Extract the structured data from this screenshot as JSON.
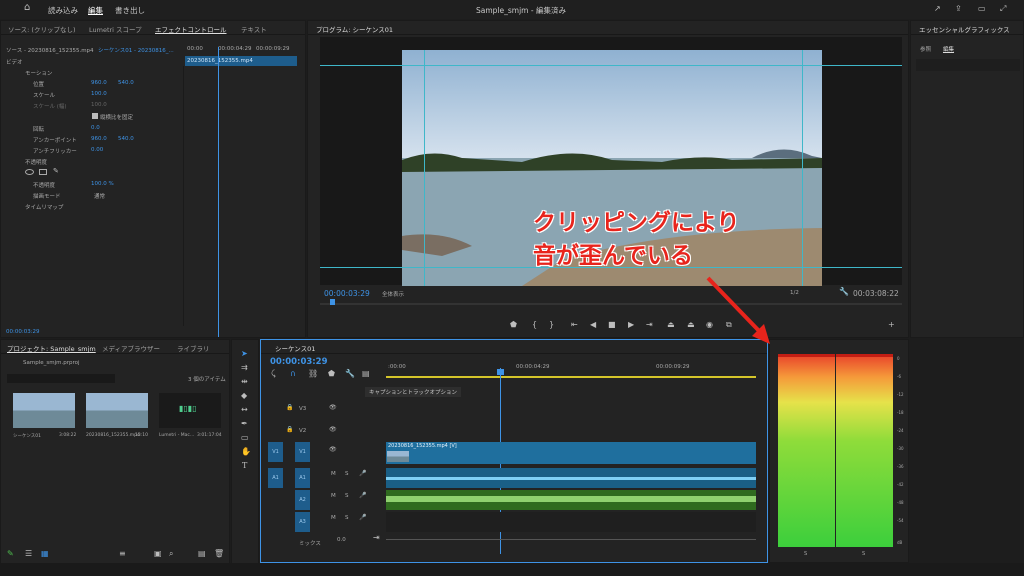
{
  "menu": {
    "home_icon": "home-icon",
    "items": [
      "読み込み",
      "編集",
      "書き出し"
    ],
    "title": "Sample_smjm - 編集済み"
  },
  "source": {
    "tabs": [
      "ソース: (クリップなし)",
      "Lumetri スコープ",
      "エフェクトコントロール",
      "テキスト"
    ],
    "master": "ソース - 20230816_152355.mp4",
    "seq": "シーケンス01 - 20230816_...",
    "video": "ビデオ",
    "times": [
      "00:00",
      "00:00:04:29",
      "00:00:09:29"
    ],
    "clip": "20230816_152355.mp4",
    "motion": "モーション",
    "pos": "位置",
    "pos_x": "960.0",
    "pos_y": "540.0",
    "scale": "スケール",
    "scale_v": "100.0",
    "scale_w": "スケール (幅)",
    "scale_w_v": "100.0",
    "uniform": "縦横比を固定",
    "rotation": "回転",
    "rotation_v": "0.0",
    "anchor": "アンカーポイント",
    "anchor_x": "960.0",
    "anchor_y": "540.0",
    "anti": "アンチフリッカー",
    "anti_v": "0.00",
    "opacity_grp": "不透明度",
    "opacity": "不透明度",
    "opacity_v": "100.0 %",
    "blend": "描画モード",
    "blend_v": "通常",
    "remap": "タイムリマップ",
    "tc": "00:00:03:29"
  },
  "program": {
    "title": "プログラム: シーケンス01",
    "tc": "00:00:03:29",
    "fit": "全体表示",
    "res": "1/2",
    "dur": "00:03:08:22"
  },
  "annotation": {
    "line1": "クリッピングにより",
    "line2": "音が歪んでいる"
  },
  "essential": {
    "title": "エッセンシャルグラフィックス",
    "tab1": "参照",
    "tab2": "編集"
  },
  "project": {
    "tabs": [
      "プロジェクト: Sample_smjm",
      "メディアブラウザー",
      "ライブラリ"
    ],
    "file": "Sample_smjm.prproj",
    "count": "3 個のアイテム",
    "items": [
      {
        "name": "シーケンス01",
        "dur": "3:08:22"
      },
      {
        "name": "20230816_152355.mp4",
        "dur": "13:10"
      },
      {
        "name": "Lumetri - Mac...",
        "dur": "3:01:17:04"
      }
    ]
  },
  "timeline": {
    "title": "シーケンス01",
    "tc": "00:00:03:29",
    "times": [
      ":00:00",
      "00:00:04:29",
      "00:00:09:29"
    ],
    "tooltip": "キャプションとトラックオプション",
    "v3": "V3",
    "v2": "V2",
    "v1": "V1",
    "a1": "A1",
    "a2": "A2",
    "a3": "A3",
    "mix": "ミックス",
    "mix_v": "0.0",
    "v1src": "V1",
    "a1src": "A1",
    "clip": "20230816_152355.mp4 [V]",
    "m": "M",
    "s": "S"
  },
  "meter": {
    "scale": [
      "0",
      "-6",
      "-12",
      "-18",
      "-24",
      "-30",
      "-36",
      "-42",
      "-48",
      "-54",
      "dB"
    ],
    "solo": [
      "S",
      "S"
    ],
    "accent_top": "#e8402a",
    "accent_bottom": "#3ccf3c"
  }
}
